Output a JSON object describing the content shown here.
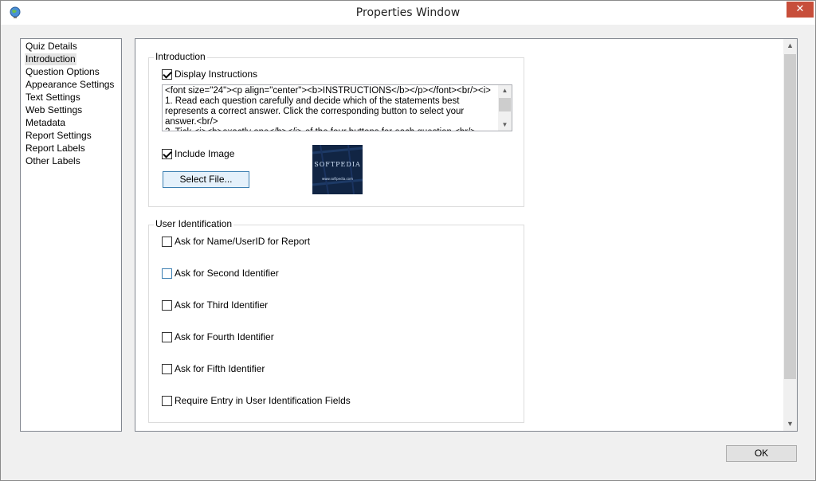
{
  "window": {
    "title": "Properties Window",
    "close_glyph": "✕"
  },
  "icons": {
    "app": "app-globe-icon",
    "close": "close-icon"
  },
  "nav": {
    "items": [
      {
        "label": "Quiz Details"
      },
      {
        "label": "Introduction",
        "selected": true
      },
      {
        "label": "Question Options"
      },
      {
        "label": "Appearance Settings"
      },
      {
        "label": "Text Settings"
      },
      {
        "label": "Web Settings"
      },
      {
        "label": "Metadata"
      },
      {
        "label": "Report Settings"
      },
      {
        "label": "Report Labels"
      },
      {
        "label": "Other Labels"
      }
    ]
  },
  "introduction": {
    "title": "Introduction",
    "display_instructions": {
      "label": "Display Instructions",
      "checked": true
    },
    "instructions_text": "<font size=\"24\"><p align=\"center\"><b>INSTRUCTIONS</b></p></font><br/><i> 1. Read each question carefully and decide which of the statements best represents a correct answer. Click the corresponding button to select your answer.<br/>\n2. Tick <i><b>exactly one</b></i> of the four buttons for each question.<br/>",
    "include_image": {
      "label": "Include Image",
      "checked": true
    },
    "select_file_label": "Select File...",
    "preview": {
      "logo_text": "SOFTPEDIA",
      "url_text": "www.softpedia.com"
    }
  },
  "user_identification": {
    "title": "User Identification",
    "options": [
      {
        "label": "Ask for Name/UserID for Report",
        "checked": false
      },
      {
        "label": "Ask for Second Identifier",
        "checked": false
      },
      {
        "label": "Ask for Third Identifier",
        "checked": false
      },
      {
        "label": "Ask for Fourth Identifier",
        "checked": false
      },
      {
        "label": "Ask for Fifth Identifier",
        "checked": false
      },
      {
        "label": "Require Entry in User Identification Fields",
        "checked": false
      }
    ]
  },
  "footer": {
    "ok_label": "OK"
  },
  "colors": {
    "close_button": "#c74e3a",
    "selection": "#e4e4e4",
    "preview_background": "#112544"
  }
}
